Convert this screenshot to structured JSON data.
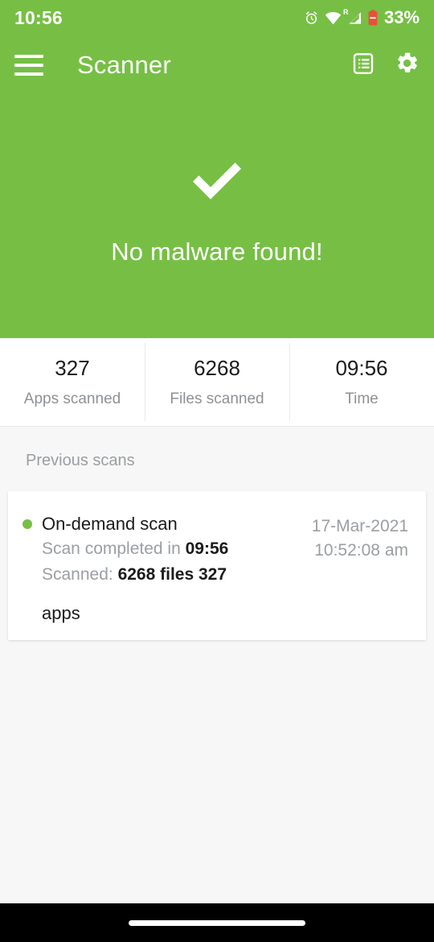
{
  "status_bar": {
    "time": "10:56",
    "battery_percent": "33%",
    "roaming_label": "R",
    "icons": [
      "alarm-icon",
      "wifi-icon",
      "cellular-signal-icon",
      "battery-icon"
    ]
  },
  "app_bar": {
    "title": "Scanner",
    "menu_icon": "hamburger-menu-icon",
    "actions": [
      {
        "name": "reports-icon",
        "label": "Reports"
      },
      {
        "name": "settings-gear-icon",
        "label": "Settings"
      }
    ]
  },
  "hero": {
    "result_icon": "checkmark-icon",
    "message": "No malware found!",
    "background_color": "#76bf44"
  },
  "stats": [
    {
      "value": "327",
      "label": "Apps scanned"
    },
    {
      "value": "6268",
      "label": "Files scanned"
    },
    {
      "value": "09:56",
      "label": "Time"
    }
  ],
  "previous_scans": {
    "section_title": "Previous scans",
    "items": [
      {
        "status_dot_color": "#76bf44",
        "title": "On-demand scan",
        "duration_prefix": "Scan completed in ",
        "duration_value": "09:56",
        "scanned_prefix": "Scanned: ",
        "scanned_files": "6268",
        "scanned_files_suffix": " files ",
        "scanned_apps": "327",
        "overflow_text": "apps",
        "date": "17-Mar-2021",
        "time": "10:52:08 am"
      }
    ]
  },
  "nav_bar": {
    "gesture_pill": "home-gesture-pill"
  }
}
